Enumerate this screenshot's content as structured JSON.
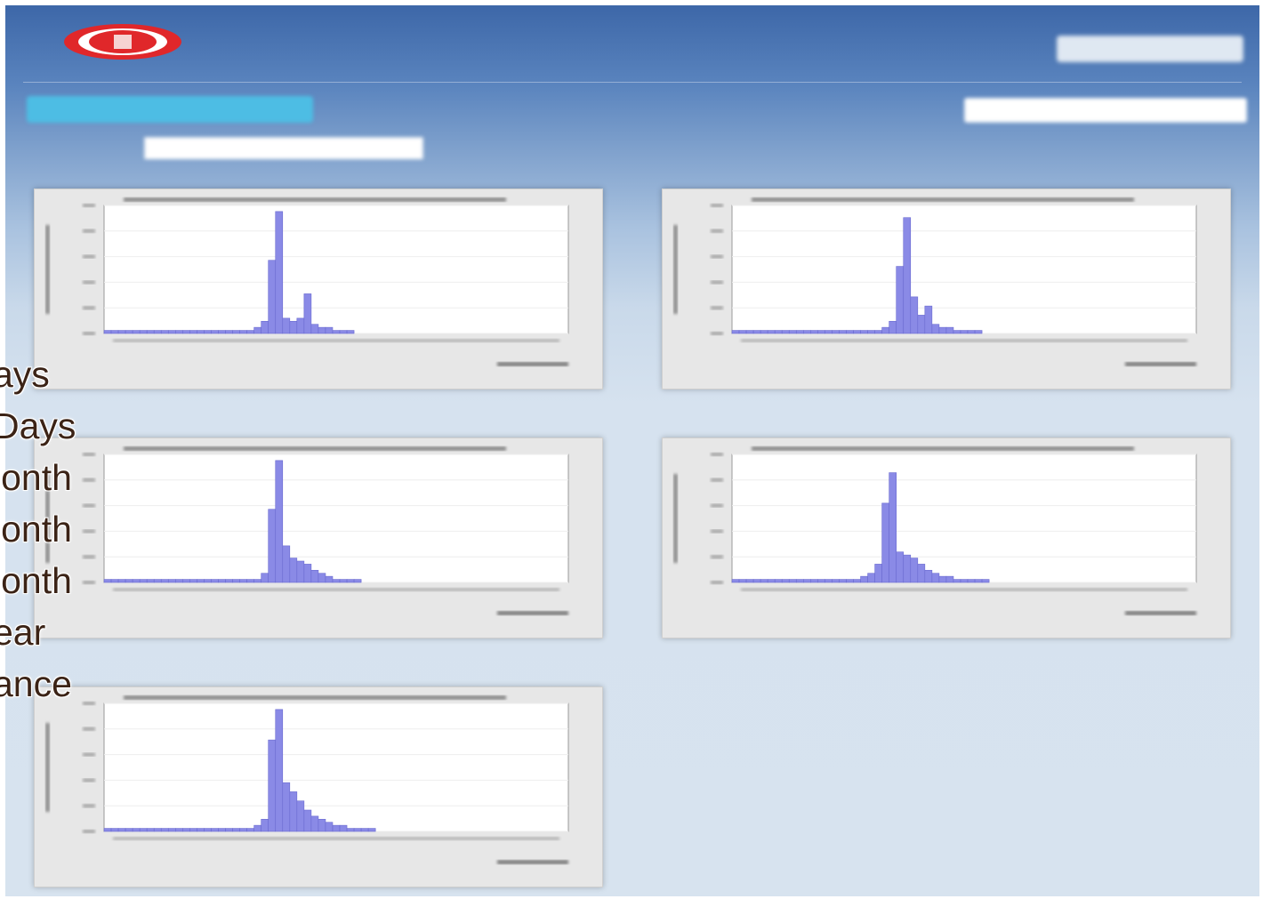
{
  "colors": {
    "header_top": "#3d67a8",
    "page_bg": "#d7e3ef",
    "primary_button": "#4dbde4",
    "bar_fill": "#8a8ae6",
    "bar_stroke": "#6a6ad0",
    "chart_panel": "#e7e7e7",
    "overlay_text": "#3b2316",
    "logo_red": "#e0272a"
  },
  "header": {
    "logo_icon": "oval-red-logo",
    "user_text": "",
    "top_button_label": ""
  },
  "toolbar": {
    "primary_button_label": "",
    "search_placeholder": ""
  },
  "tabs": [
    {
      "label": ""
    },
    {
      "label": ""
    },
    {
      "label": ""
    },
    {
      "label": ""
    },
    {
      "label": ""
    }
  ],
  "overlay_labels": [
    "ays",
    "Days",
    "lonth",
    "lonth",
    "lonth",
    "ear",
    "ance"
  ],
  "charts": [
    {
      "section_label": "",
      "chart_data": {
        "type": "bar",
        "title": "",
        "xlabel": "",
        "ylabel": "",
        "values": [
          1,
          1,
          1,
          1,
          1,
          1,
          1,
          1,
          1,
          1,
          1,
          1,
          1,
          1,
          1,
          1,
          1,
          1,
          1,
          1,
          1,
          2,
          4,
          24,
          40,
          5,
          4,
          5,
          13,
          3,
          2,
          2,
          1,
          1,
          1,
          0,
          0,
          0,
          0,
          0,
          0,
          0,
          0,
          0,
          0,
          0,
          0,
          0,
          0,
          0,
          0,
          0,
          0,
          0,
          0,
          0,
          0,
          0,
          0,
          0,
          0,
          0,
          0,
          0,
          0
        ],
        "ylim": [
          0,
          42
        ]
      }
    },
    {
      "section_label": "",
      "chart_data": {
        "type": "bar",
        "title": "",
        "xlabel": "",
        "ylabel": "",
        "values": [
          1,
          1,
          1,
          1,
          1,
          1,
          1,
          1,
          1,
          1,
          1,
          1,
          1,
          1,
          1,
          1,
          1,
          1,
          1,
          1,
          1,
          2,
          4,
          22,
          38,
          12,
          6,
          9,
          3,
          2,
          2,
          1,
          1,
          1,
          1,
          0,
          0,
          0,
          0,
          0,
          0,
          0,
          0,
          0,
          0,
          0,
          0,
          0,
          0,
          0,
          0,
          0,
          0,
          0,
          0,
          0,
          0,
          0,
          0,
          0,
          0,
          0,
          0,
          0,
          0
        ],
        "ylim": [
          0,
          42
        ]
      }
    },
    {
      "section_label": "",
      "chart_data": {
        "type": "bar",
        "title": "",
        "xlabel": "",
        "ylabel": "",
        "values": [
          1,
          1,
          1,
          1,
          1,
          1,
          1,
          1,
          1,
          1,
          1,
          1,
          1,
          1,
          1,
          1,
          1,
          1,
          1,
          1,
          1,
          1,
          3,
          24,
          40,
          12,
          8,
          7,
          6,
          4,
          3,
          2,
          1,
          1,
          1,
          1,
          0,
          0,
          0,
          0,
          0,
          0,
          0,
          0,
          0,
          0,
          0,
          0,
          0,
          0,
          0,
          0,
          0,
          0,
          0,
          0,
          0,
          0,
          0,
          0,
          0,
          0,
          0,
          0,
          0
        ],
        "ylim": [
          0,
          42
        ]
      }
    },
    {
      "section_label": "",
      "chart_data": {
        "type": "bar",
        "title": "",
        "xlabel": "",
        "ylabel": "",
        "values": [
          1,
          1,
          1,
          1,
          1,
          1,
          1,
          1,
          1,
          1,
          1,
          1,
          1,
          1,
          1,
          1,
          1,
          1,
          2,
          3,
          6,
          26,
          36,
          10,
          9,
          8,
          6,
          4,
          3,
          2,
          2,
          1,
          1,
          1,
          1,
          1,
          0,
          0,
          0,
          0,
          0,
          0,
          0,
          0,
          0,
          0,
          0,
          0,
          0,
          0,
          0,
          0,
          0,
          0,
          0,
          0,
          0,
          0,
          0,
          0,
          0,
          0,
          0,
          0,
          0
        ],
        "ylim": [
          0,
          42
        ]
      }
    },
    {
      "section_label": "",
      "chart_data": {
        "type": "bar",
        "title": "",
        "xlabel": "",
        "ylabel": "",
        "values": [
          1,
          1,
          1,
          1,
          1,
          1,
          1,
          1,
          1,
          1,
          1,
          1,
          1,
          1,
          1,
          1,
          1,
          1,
          1,
          1,
          1,
          2,
          4,
          30,
          40,
          16,
          13,
          10,
          7,
          5,
          4,
          3,
          2,
          2,
          1,
          1,
          1,
          1,
          0,
          0,
          0,
          0,
          0,
          0,
          0,
          0,
          0,
          0,
          0,
          0,
          0,
          0,
          0,
          0,
          0,
          0,
          0,
          0,
          0,
          0,
          0,
          0,
          0,
          0,
          0
        ],
        "ylim": [
          0,
          42
        ]
      }
    }
  ]
}
